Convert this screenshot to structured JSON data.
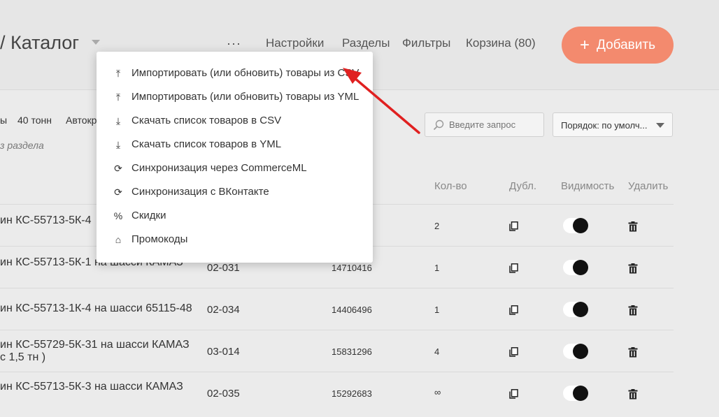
{
  "header": {
    "title": "/ Каталог",
    "more_label": "···",
    "nav": [
      "Настройки",
      "Разделы",
      "Фильтры",
      "Корзина (80)"
    ],
    "add_button": {
      "icon": "+",
      "label": "Добавить"
    }
  },
  "filters": {
    "chips": [
      "ы",
      "40 тонн",
      "Автокр"
    ],
    "subnote": "з раздела"
  },
  "search": {
    "placeholder": "Введите запрос",
    "icon": "search-icon"
  },
  "sort": {
    "selected": "Порядок: по умолч..."
  },
  "table": {
    "headers": [
      "Кол-во",
      "Дубл.",
      "Видимость",
      "Удалить"
    ],
    "rows": [
      {
        "name": "ин КС-55713-5К-4",
        "name2": "",
        "sku": "",
        "code": "",
        "qty": "2"
      },
      {
        "name": "ин КС-55713-5К-1 на шасси КАМАЗ",
        "name2": "",
        "sku": "02-031",
        "code": "14710416",
        "qty": "1"
      },
      {
        "name": "ин КС-55713-1К-4 на шасси 65115-48",
        "name2": "",
        "sku": "02-034",
        "code": "14406496",
        "qty": "1"
      },
      {
        "name": "ин КС-55729-5К-31 на шасси КАМАЗ",
        "name2": "с 1,5 тн )",
        "sku": "03-014",
        "code": "15831296",
        "qty": "4"
      },
      {
        "name": "ин КС-55713-5К-3 на шасси КАМАЗ",
        "name2": "",
        "sku": "02-035",
        "code": "15292683",
        "qty": "∞"
      }
    ]
  },
  "menu": {
    "items": [
      {
        "icon": "upload-icon",
        "glyph": "⤒",
        "label": "Импортировать (или обновить) товары из CSV"
      },
      {
        "icon": "upload-icon",
        "glyph": "⤒",
        "label": "Импортировать (или обновить) товары из YML"
      },
      {
        "icon": "download-icon",
        "glyph": "⤓",
        "label": "Скачать список товаров в CSV"
      },
      {
        "icon": "download-icon",
        "glyph": "⤓",
        "label": "Скачать список товаров в YML"
      },
      {
        "icon": "sync-icon",
        "glyph": "⟳",
        "label": "Синхронизация через CommerceML"
      },
      {
        "icon": "sync-icon",
        "glyph": "⟳",
        "label": "Синхронизация с ВКонтакте"
      },
      {
        "icon": "percent-icon",
        "glyph": "%",
        "label": "Скидки"
      },
      {
        "icon": "tag-icon",
        "glyph": "⌂",
        "label": "Промокоды"
      }
    ]
  },
  "colors": {
    "accent": "#f38a6e",
    "annotation_arrow": "#e02020",
    "toggle_on": "#111111"
  }
}
